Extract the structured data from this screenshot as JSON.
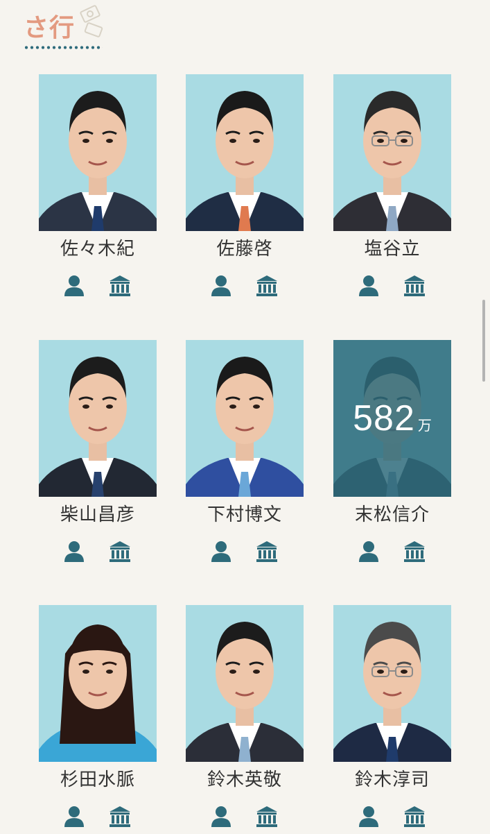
{
  "section": {
    "title": "さ行"
  },
  "colors": {
    "background": "#f6f4ef",
    "accent": "#2e6b7b",
    "title": "#e39a80",
    "photo_background": "#a9dbe3"
  },
  "cards": [
    {
      "name": "佐々木紀",
      "icons": [
        "person-icon",
        "building-icon"
      ]
    },
    {
      "name": "佐藤啓",
      "icons": [
        "person-icon",
        "building-icon"
      ]
    },
    {
      "name": "塩谷立",
      "icons": [
        "person-icon",
        "building-icon"
      ]
    },
    {
      "name": "柴山昌彦",
      "icons": [
        "person-icon",
        "building-icon"
      ]
    },
    {
      "name": "下村博文",
      "icons": [
        "person-icon",
        "building-icon"
      ]
    },
    {
      "name": "末松信介",
      "overlay": {
        "amount": "582",
        "unit": "万"
      },
      "icons": [
        "person-icon",
        "building-icon"
      ]
    },
    {
      "name": "杉田水脈",
      "icons": [
        "person-icon",
        "building-icon"
      ]
    },
    {
      "name": "鈴木英敬",
      "icons": [
        "person-icon",
        "building-icon"
      ]
    },
    {
      "name": "鈴木淳司",
      "icons": [
        "person-icon",
        "building-icon"
      ]
    }
  ]
}
